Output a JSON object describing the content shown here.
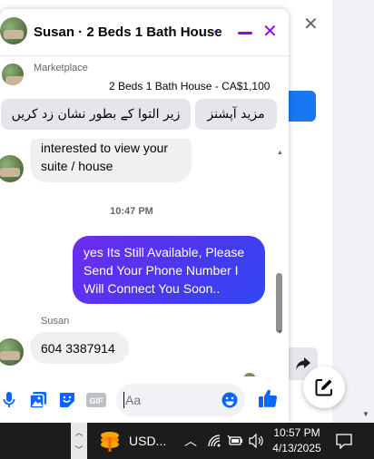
{
  "colors": {
    "accent": "#9b00e8",
    "outgoing_bubble_start": "#6f2cf0",
    "outgoing_bubble_end": "#2f49f2",
    "incoming_bubble": "#f0f0f0",
    "like_blue": "#0866ff",
    "taskbar": "#1c1c1c"
  },
  "chat": {
    "title": "Susan · 2 Beds 1 Bath House",
    "icons": {
      "chevron": "chevron-down-icon",
      "minimize": "minimize-icon",
      "close": "close-icon"
    },
    "marketplace": {
      "label": "Marketplace",
      "listing": "2 Beds 1 Bath House - CA$1,100"
    },
    "quick_actions": [
      {
        "label": "زیر التوا کے بطور نشان زد کریں"
      },
      {
        "label": "مزید آپشنز"
      }
    ],
    "messages": {
      "incoming_1": {
        "line1": "interested to view your",
        "line2": "suite / house"
      },
      "timestamp": "10:47 PM",
      "outgoing_1": {
        "line1": "yes Its Still Available, Please",
        "line2": "Send Your Phone Number I",
        "line3": "Will Connect You Soon.."
      },
      "sender": "Susan",
      "incoming_2": "604 3387914"
    },
    "composer": {
      "placeholder": "Aa",
      "tools": [
        "microphone-icon",
        "photo-icon",
        "sticker-icon",
        "gif-icon"
      ],
      "gif_label": "GIF",
      "emoji_icon": "emoji-icon",
      "like_icon": "thumbs-up-icon"
    }
  },
  "background": {
    "close_icon": "close-icon",
    "share_icon": "share-icon",
    "compose_icon": "compose-icon"
  },
  "taskbar": {
    "app_label": "USD...",
    "clock_time": "10:57 PM",
    "clock_date": "4/13/2025",
    "tray_icons": [
      "chevron-up-icon",
      "wifi-icon",
      "battery-icon",
      "speaker-icon",
      "notification-icon"
    ]
  }
}
